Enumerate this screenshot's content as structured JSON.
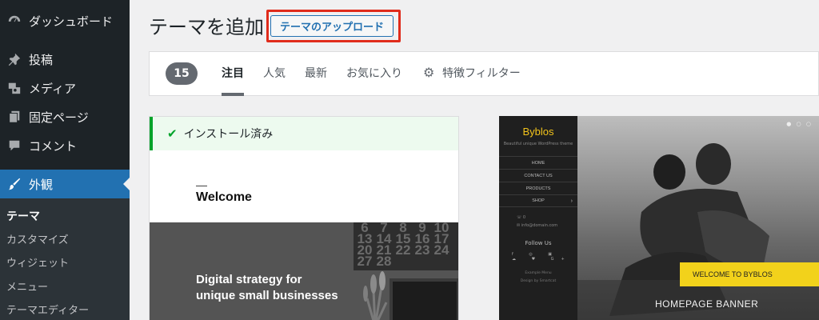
{
  "sidebar": {
    "items": [
      {
        "label": "ダッシュボード",
        "icon": "dashboard-icon"
      },
      {
        "label": "投稿",
        "icon": "pin-icon"
      },
      {
        "label": "メディア",
        "icon": "media-icon"
      },
      {
        "label": "固定ページ",
        "icon": "pages-icon"
      },
      {
        "label": "コメント",
        "icon": "comment-icon"
      },
      {
        "label": "外観",
        "icon": "brush-icon"
      }
    ],
    "submenu": [
      "テーマ",
      "カスタマイズ",
      "ウィジェット",
      "メニュー",
      "テーマエディター"
    ]
  },
  "header": {
    "title": "テーマを追加",
    "upload_button": "テーマのアップロード"
  },
  "filter_bar": {
    "count": "15",
    "tabs": [
      "注目",
      "人気",
      "最新",
      "お気に入り"
    ],
    "feature_filter": "特徴フィルター"
  },
  "theme1": {
    "notice": "インストール済み",
    "welcome": "Welcome",
    "hero_line1": "Digital strategy for",
    "hero_line2": "unique small businesses",
    "calendar": [
      "6",
      "7",
      "8",
      "9",
      "10",
      "13",
      "14",
      "15",
      "16",
      "17",
      "20",
      "21",
      "22",
      "23",
      "24",
      "27",
      "28"
    ]
  },
  "theme2": {
    "title": "Byblos",
    "tagline": "Beautiful unique WordPress theme",
    "nav": [
      "HOME",
      "CONTACT US",
      "PRODUCTS",
      "SHOP"
    ],
    "phone": "0",
    "email": "info@domain.com",
    "follow": "Follow Us",
    "social": "f ◎ ▣ ☁ ♥ G+",
    "foot1": "Example Menu",
    "foot2": "Design by Smartcat",
    "banner": "WELCOME TO BYBLOS",
    "homepage": "HOMEPAGE BANNER"
  },
  "colors": {
    "sidebar_bg": "#1d2327",
    "accent": "#2271b1",
    "highlight_border": "#e02b1b",
    "installed_green": "#00a32a",
    "byblos_yellow": "#f2d21b"
  }
}
